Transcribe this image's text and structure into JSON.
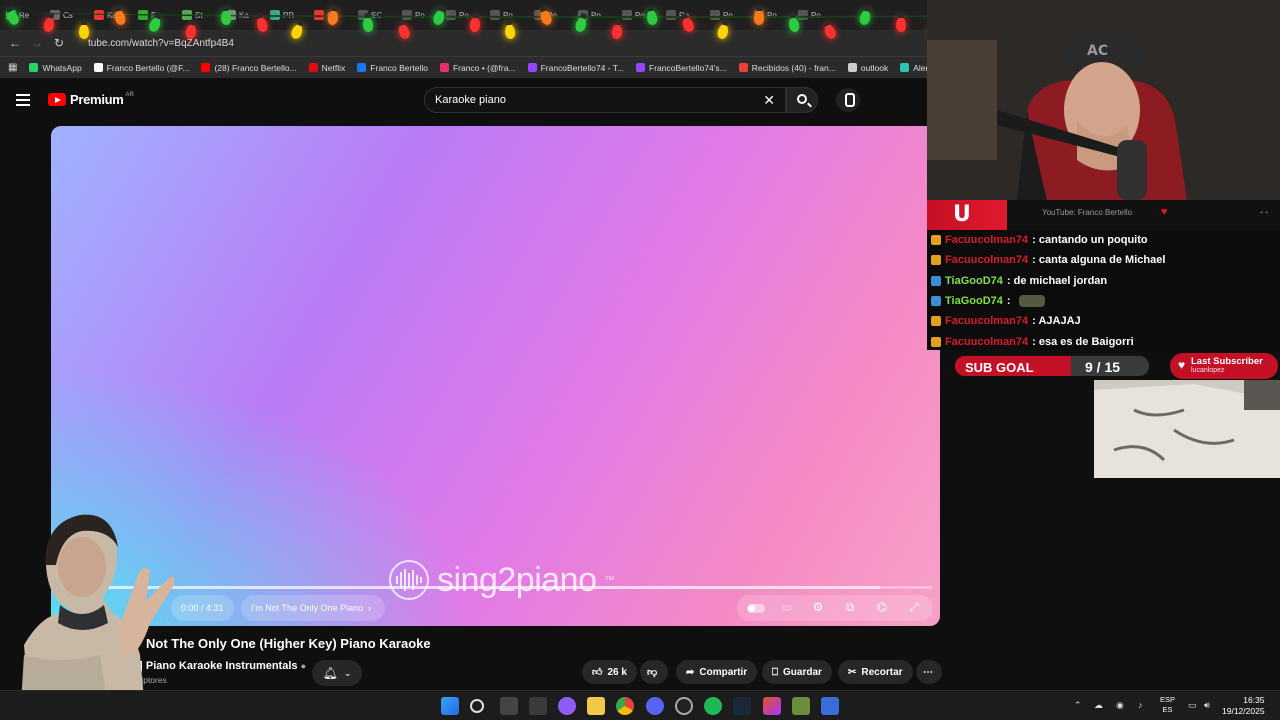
{
  "browser": {
    "tabs": [
      "Re",
      "Cs",
      "Ka",
      "Fr",
      "St",
      "Ka",
      "PR",
      "(2)",
      "SC",
      "Po",
      "Po",
      "Po",
      "Po",
      "Po",
      "Po",
      "Po",
      "Po",
      "Po",
      "Po"
    ],
    "url": "tube.com/watch?v=BqZAntfp4B4",
    "bookmarks": [
      {
        "label": "WhatsApp",
        "color": "#25d366"
      },
      {
        "label": "Franco Bertello (@F...",
        "color": "#ffffff"
      },
      {
        "label": "(28) Franco Bertello...",
        "color": "#ff0000"
      },
      {
        "label": "Netflix",
        "color": "#e50914"
      },
      {
        "label": "Franco Bertello",
        "color": "#1877f2"
      },
      {
        "label": "Franco • (@fra...",
        "color": "#e1306c"
      },
      {
        "label": "FrancoBertello74 - T...",
        "color": "#9146ff"
      },
      {
        "label": "FrancoBertello74's...",
        "color": "#9146ff"
      },
      {
        "label": "Recibidos (40) - fran...",
        "color": "#ea4335"
      },
      {
        "label": "outlook",
        "color": "#cccccc"
      },
      {
        "label": "Alert",
        "color": "#2ec4b6"
      }
    ]
  },
  "youtube": {
    "brand": "Premium",
    "country": "AR",
    "search_query": "Karaoke piano",
    "player": {
      "watermark": "sing2piano",
      "watermark_tm": "™",
      "time": "0:00 / 4:31",
      "chapter": "I'm Not The Only One Piano",
      "progress_fraction": 0.0,
      "buffer_fraction": 0.94
    },
    "video_title": "Not The Only One (Higher Key) Piano Karaoke",
    "channel": "o | Piano Karaoke Instrumentals",
    "subscribers": "scriptores",
    "actions": {
      "likes": "26 k",
      "share": "Compartir",
      "save": "Guardar",
      "clip": "Recortar"
    }
  },
  "stream": {
    "yt_channel": "YouTube: Franco Bertello",
    "logo_letter": "U",
    "chat": [
      {
        "user": "Facuucolman74",
        "text": ": cantando un poquito",
        "color": "red"
      },
      {
        "user": "Facuucolman74",
        "text": ": canta alguna de Michael",
        "color": "red"
      },
      {
        "user": "TiaGooD74",
        "text": ": de michael jordan",
        "color": "green"
      },
      {
        "user": "TiaGooD74",
        "text": ":",
        "color": "green"
      },
      {
        "user": "Facuucolman74",
        "text": ": AJAJAJ",
        "color": "red"
      },
      {
        "user": "Facuucolman74",
        "text": ": esa es de Baigorri",
        "color": "red"
      }
    ],
    "sub_goal": {
      "label": "SUB GOAL",
      "current": 9,
      "target": 15,
      "display": "9 / 15"
    },
    "last_subscriber": {
      "title": "Last Subscriber",
      "name": "lucanlopez"
    }
  },
  "taskbar": {
    "lang_top": "ESP",
    "lang_bottom": "ES",
    "time": "16:35",
    "date": "19/12/2025"
  },
  "colors": {
    "accent": "#c41026",
    "yt_red": "#ff0000",
    "chat_red": "#d51d2b",
    "chat_green": "#7fe24a"
  }
}
